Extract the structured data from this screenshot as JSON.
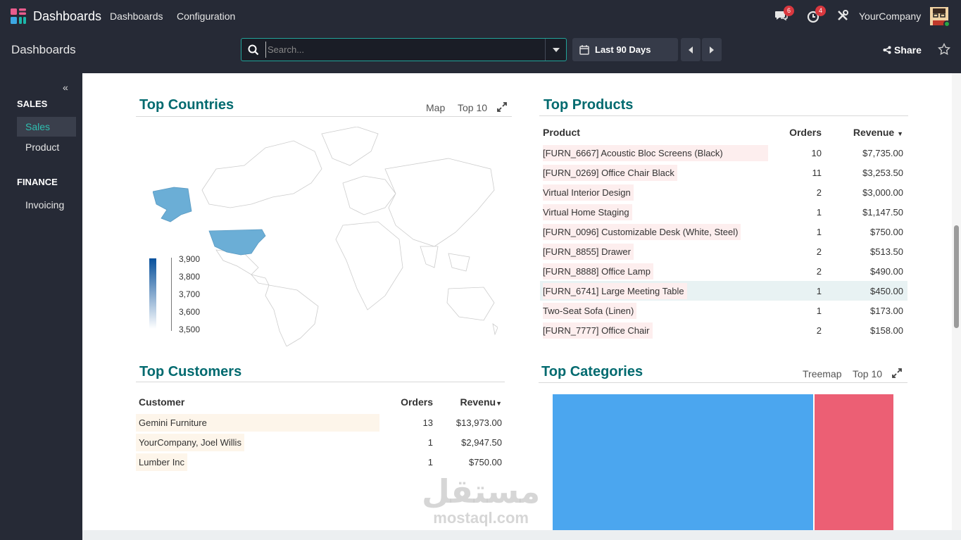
{
  "topbar": {
    "app_name": "Dashboards",
    "menu": [
      "Dashboards",
      "Configuration"
    ],
    "messages_count": "6",
    "activities_count": "4",
    "company": "YourCompany"
  },
  "control_panel": {
    "breadcrumb": "Dashboards",
    "search_placeholder": "Search...",
    "date_filter": "Last 90 Days",
    "share_label": "Share"
  },
  "sidebar": {
    "sections": [
      {
        "title": "SALES",
        "items": [
          {
            "label": "Sales",
            "active": true
          },
          {
            "label": "Product",
            "active": false
          }
        ]
      },
      {
        "title": "FINANCE",
        "items": [
          {
            "label": "Invoicing",
            "active": false
          }
        ]
      }
    ]
  },
  "top_countries": {
    "title": "Top Countries",
    "tool_chart": "Map",
    "tool_limit": "Top 10",
    "legend": [
      "3,900",
      "3,800",
      "3,700",
      "3,600",
      "3,500"
    ]
  },
  "top_products": {
    "title": "Top Products",
    "columns": [
      "Product",
      "Orders",
      "Revenue"
    ],
    "rows": [
      {
        "product": "[FURN_6667] Acoustic Bloc Screens (Black)",
        "orders": "10",
        "revenue": "$7,735.00"
      },
      {
        "product": "[FURN_0269] Office Chair Black",
        "orders": "11",
        "revenue": "$3,253.50"
      },
      {
        "product": "Virtual Interior Design",
        "orders": "2",
        "revenue": "$3,000.00"
      },
      {
        "product": "Virtual Home Staging",
        "orders": "1",
        "revenue": "$1,147.50"
      },
      {
        "product": "[FURN_0096] Customizable Desk (White, Steel)",
        "orders": "1",
        "revenue": "$750.00"
      },
      {
        "product": "[FURN_8855] Drawer",
        "orders": "2",
        "revenue": "$513.50"
      },
      {
        "product": "[FURN_8888] Office Lamp",
        "orders": "2",
        "revenue": "$490.00"
      },
      {
        "product": "[FURN_6741] Large Meeting Table",
        "orders": "1",
        "revenue": "$450.00"
      },
      {
        "product": "Two-Seat Sofa (Linen)",
        "orders": "1",
        "revenue": "$173.00"
      },
      {
        "product": "[FURN_7777] Office Chair",
        "orders": "2",
        "revenue": "$158.00"
      }
    ]
  },
  "top_customers": {
    "title": "Top Customers",
    "columns": [
      "Customer",
      "Orders",
      "Revenu"
    ],
    "rows": [
      {
        "customer": "Gemini Furniture",
        "orders": "13",
        "revenue": "$13,973.00"
      },
      {
        "customer": "YourCompany, Joel Willis",
        "orders": "1",
        "revenue": "$2,947.50"
      },
      {
        "customer": "Lumber Inc",
        "orders": "1",
        "revenue": "$750.00"
      }
    ]
  },
  "top_categories": {
    "title": "Top Categories",
    "tool_chart": "Treemap",
    "tool_limit": "Top 10",
    "colors": [
      "#4ba6ef",
      "#ec5f74"
    ]
  },
  "watermark": {
    "arabic": "مستقل",
    "latin": "mostaql.com"
  },
  "colors": {
    "accent": "#016a6f",
    "active_menu": "#2fbfb1",
    "map_fill": "#6baed6"
  }
}
